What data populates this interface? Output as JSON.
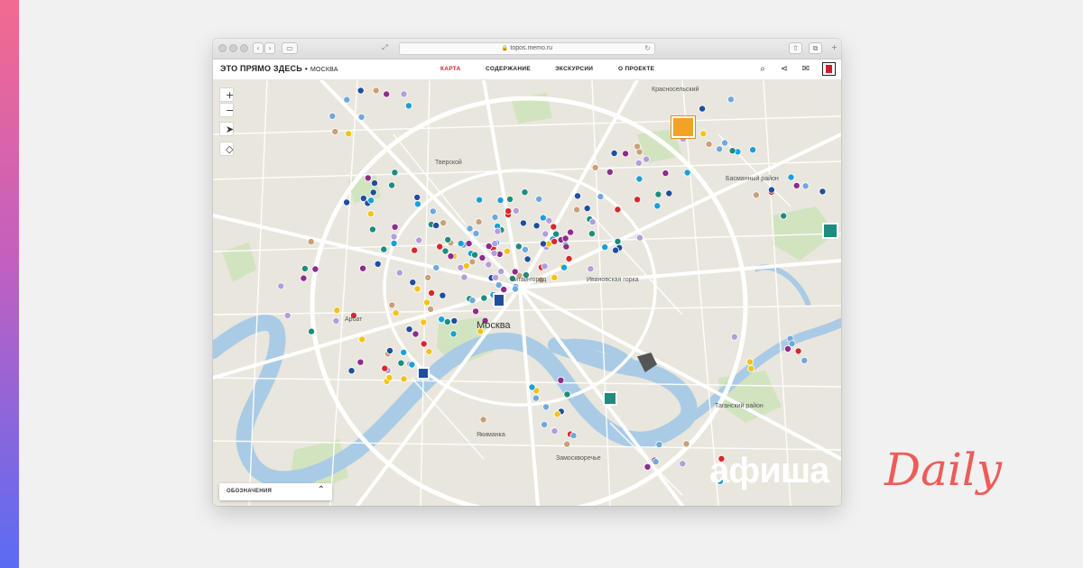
{
  "browser": {
    "url": "topos.memo.ru",
    "lock_glyph": "🔒",
    "reload_glyph": "↻",
    "back_glyph": "‹",
    "forward_glyph": "›",
    "sidebar_glyph": "▭",
    "share_glyph": "⇧",
    "tabs_glyph": "⧉",
    "newtab_glyph": "+",
    "resize_glyph": "⤢"
  },
  "app": {
    "title": "ЭТО ПРЯМО ЗДЕСЬ",
    "separator": "•",
    "city": "МОСКВА",
    "nav": [
      "КАРТА",
      "СОДЕРЖАНИЕ",
      "ЭКСКУРСИИ",
      "О ПРОЕКТЕ"
    ],
    "active_nav": "КАРТА",
    "accent_color": "#c8222e",
    "icons": {
      "search": "⌕",
      "share": "⋖",
      "mail": "✉"
    }
  },
  "map": {
    "zoom_in": "+",
    "zoom_out": "−",
    "locate_glyph": "➤",
    "layers_glyph": "◇",
    "labels": {
      "krasnoselsky": "Красносельский",
      "tverskoy": "Тверской",
      "basmanny": "Басманный район",
      "kitay_gorod": "Китай-город",
      "ivanovskaya": "Ивановская горка",
      "arbat": "Арбат",
      "moskva": "Москва",
      "taganskiy": "Таганский район",
      "yakimanka": "Якиманка",
      "zamoskvorechye": "Замоскворечье"
    },
    "legend_label": "ОБОЗНАЧЕНИЯ",
    "legend_chevron": "⌃",
    "marker_colors": [
      "#1f4e9e",
      "#6fa8dc",
      "#1aa0d8",
      "#b39ddb",
      "#1e8c7e",
      "#f2c318",
      "#c8a07a",
      "#8e2b8b",
      "#d6282e"
    ]
  },
  "overlay": {
    "afisha": "афиша",
    "daily": "Daily",
    "daily_color": "#ee5b58"
  }
}
